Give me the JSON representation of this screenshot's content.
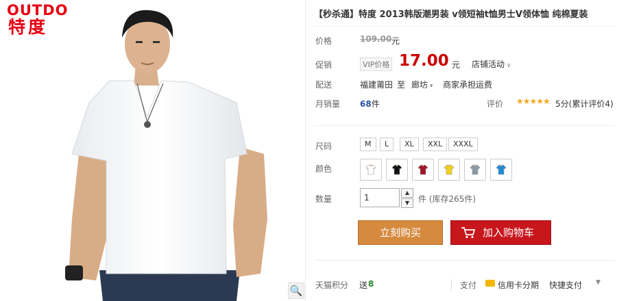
{
  "brand": {
    "en": "OUTDO",
    "cn": "特度"
  },
  "title": "【秒杀通】特度 2013韩版潮男装 v领短袖t恤男士V领体恤 纯棉夏装",
  "labels": {
    "price": "价格",
    "promo": "促销",
    "ship": "配送",
    "monthly_sales": "月销量",
    "rating": "评价",
    "size": "尺码",
    "color": "颜色",
    "qty": "数量"
  },
  "price": {
    "original": "109.00",
    "unit": "元",
    "vip_tag": "VIP价格",
    "current": "17.00",
    "promo_dropdown": "店铺活动"
  },
  "shipping": {
    "from": "福建莆田",
    "to_word": "至",
    "dest": "廊坊",
    "note": "商家承担运费"
  },
  "sales": {
    "count": "68",
    "suffix": "件"
  },
  "rating": {
    "score_text": "5分(累计评价4)",
    "stars": 5
  },
  "sizes": [
    "M",
    "L",
    "XL",
    "XXL",
    "XXXL"
  ],
  "colors": [
    "#ffffff",
    "#111111",
    "#a3142a",
    "#f2d11b",
    "#8a9aa6",
    "#1f8ad6"
  ],
  "quantity": {
    "value": "1",
    "stock": "件 (库存265件)"
  },
  "buttons": {
    "buy_now": "立刻购买",
    "add_cart": "加入购物车"
  },
  "footer": {
    "points_label": "天猫积分",
    "points_give": "送",
    "points_value": "8",
    "pay_label": "支付",
    "credit": "信用卡分期",
    "quick": "快捷支付"
  },
  "colors_ui": {
    "price_red": "#cc0000",
    "buy_orange": "#d58a3e",
    "cart_red": "#c8161d",
    "brand_red": "#e60012"
  }
}
